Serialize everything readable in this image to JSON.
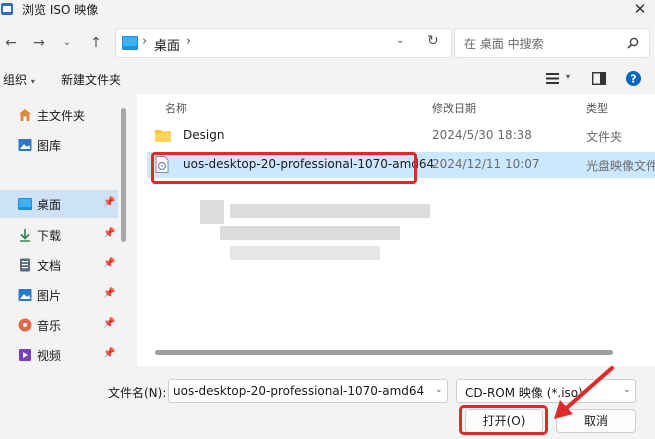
{
  "window": {
    "title": "浏览 ISO 映像"
  },
  "nav": {
    "breadcrumb": [
      "桌面"
    ],
    "search_placeholder": "在 桌面 中搜索"
  },
  "toolbar": {
    "organize_label": "组织",
    "new_folder_label": "新建文件夹"
  },
  "sidebar": {
    "items": [
      {
        "label": "主文件夹",
        "icon": "home-icon",
        "pinned": false
      },
      {
        "label": "图库",
        "icon": "gallery-icon",
        "pinned": false
      },
      {
        "label": "桌面",
        "icon": "desktop-icon",
        "pinned": true,
        "active": true
      },
      {
        "label": "下载",
        "icon": "download-icon",
        "pinned": true
      },
      {
        "label": "文档",
        "icon": "document-icon",
        "pinned": true
      },
      {
        "label": "图片",
        "icon": "pictures-icon",
        "pinned": true
      },
      {
        "label": "音乐",
        "icon": "music-icon",
        "pinned": true
      },
      {
        "label": "视频",
        "icon": "video-icon",
        "pinned": true
      }
    ]
  },
  "filelist": {
    "columns": {
      "name": "名称",
      "date": "修改日期",
      "type": "类型"
    },
    "rows": [
      {
        "name": "Design",
        "date": "2024/5/30 18:38",
        "type": "文件夹",
        "icon": "folder-icon"
      },
      {
        "name": "uos-desktop-20-professional-1070-amd64",
        "date": "2024/12/11 10:07",
        "type": "光盘映像文件",
        "icon": "disc-image-icon",
        "selected": true
      }
    ]
  },
  "bottom": {
    "filename_label": "文件名(N):",
    "filename_value": "uos-desktop-20-professional-1070-amd64",
    "filter_value": "CD-ROM 映像 (*.iso)",
    "open_label": "打开(O)",
    "cancel_label": "取消"
  },
  "colors": {
    "highlight": "#e02a2a",
    "selection": "#cce8ff",
    "accent": "#0067c0"
  }
}
